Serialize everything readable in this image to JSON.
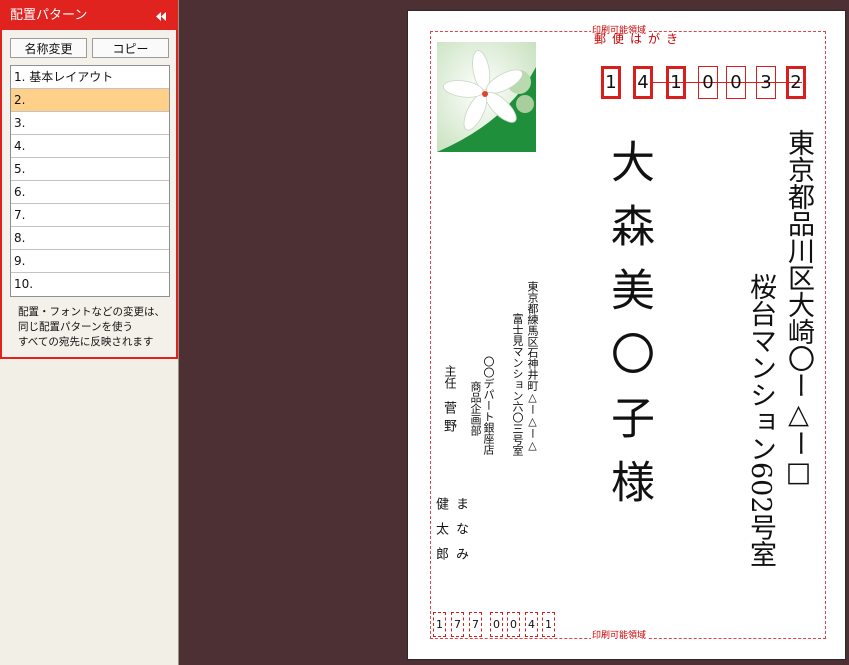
{
  "panel": {
    "title": "配置パターン",
    "rename_label": "名称変更",
    "copy_label": "コピー",
    "items": [
      "1. 基本レイアウト",
      "2.",
      "3.",
      "4.",
      "5.",
      "6.",
      "7.",
      "8.",
      "9.",
      "10."
    ],
    "selected_index": 1,
    "note_lines": [
      "配置・フォントなどの変更は、",
      "同じ配置パターンを使う",
      "すべての宛先に反映されます"
    ]
  },
  "card": {
    "print_area_label": "印刷可能領域",
    "yubin_label": "郵便はがき",
    "postal_code": [
      "1",
      "4",
      "1",
      "0",
      "0",
      "3",
      "2"
    ],
    "address_line1": "東京都品川区大崎〇ー△ー□",
    "address_line2": "桜台マンション602号室",
    "recipient": "大森美〇子様",
    "sender_address1": "東京都練馬区石神井町△ー△ー△",
    "sender_address2": "富士見マンション六〇三号室",
    "sender_company": "〇〇デパート銀座店",
    "sender_dept": "商品企画部",
    "sender_title": "主任",
    "sender_name": "菅野",
    "sender_name2a": "まなみ",
    "sender_name2b": "健太郎",
    "sender_postal_code": [
      "1",
      "7",
      "7",
      "0",
      "0",
      "4",
      "1"
    ]
  },
  "colors": {
    "accent": "#e12320",
    "selected_row": "#ffd08a",
    "stamp_green": "#1f8f3c"
  }
}
